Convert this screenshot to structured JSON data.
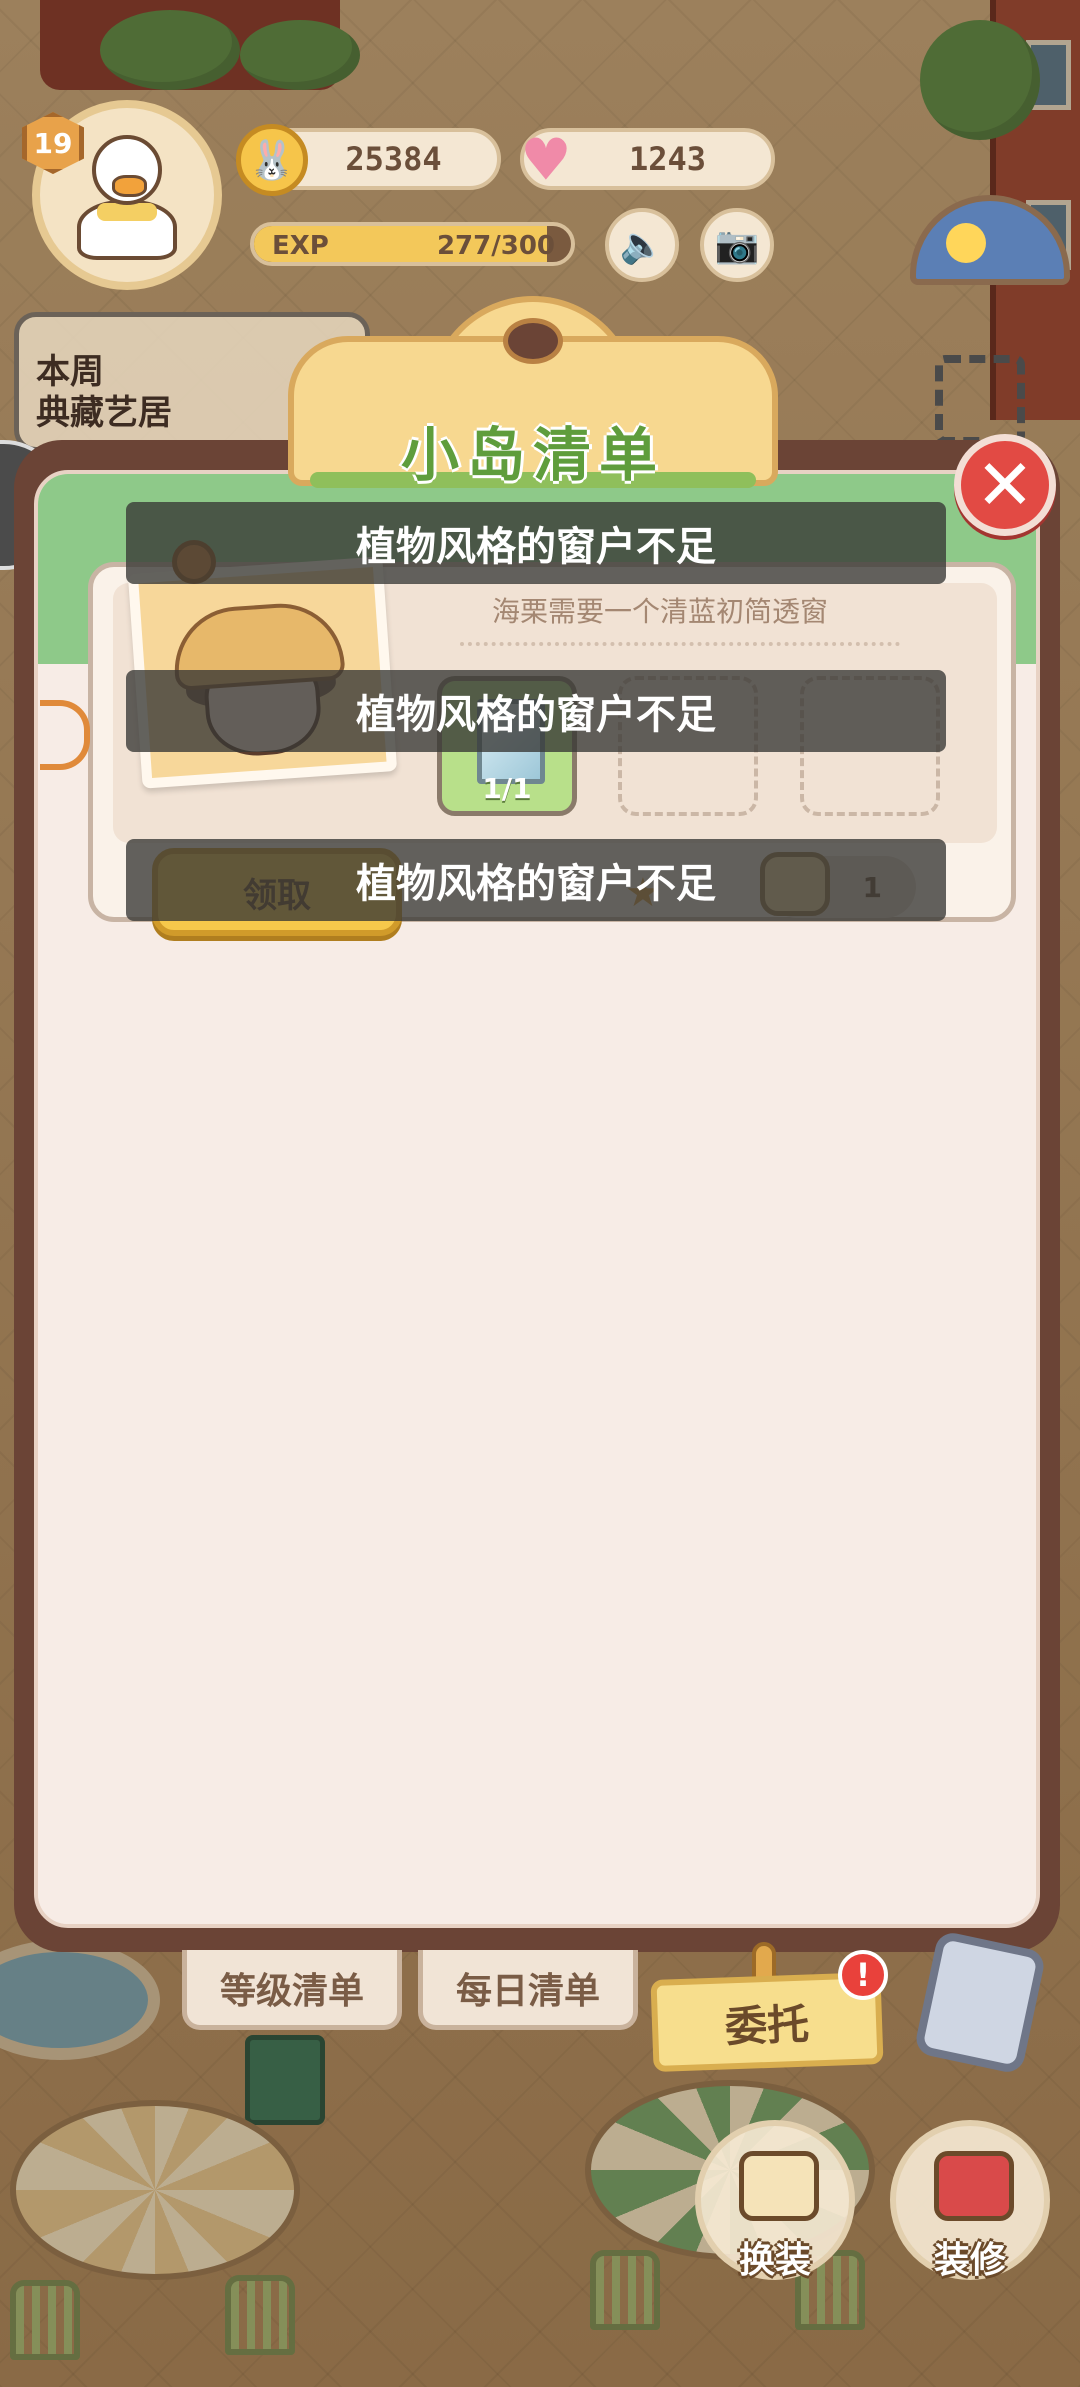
{
  "hud": {
    "level": "19",
    "coins": "25384",
    "hearts": "1243",
    "exp_label": "EXP",
    "exp_value": "277/300",
    "exp_progress": 0.923,
    "weekly_title": "本周\n典藏艺居"
  },
  "panel": {
    "title": "小岛清单",
    "task": {
      "description": "海栗需要一个清蓝初简透窗",
      "item_count": "1/1",
      "claim_label": "领取",
      "reward_amount": "1"
    }
  },
  "toasts": [
    "植物风格的窗户不足",
    "植物风格的窗户不足",
    "植物风格的窗户不足"
  ],
  "tabs": {
    "level_list": "等级清单",
    "daily_list": "每日清单",
    "commission": "委托",
    "commission_alert": "!"
  },
  "actions": {
    "outfit": "换装",
    "decorate": "装修"
  },
  "icons": {
    "level": "hexagon-badge",
    "coins": "rabbit-coin-icon",
    "hearts": "broken-heart-icon",
    "speaker": "speaker-icon",
    "camera": "camera-icon",
    "close": "close-icon",
    "fullscreen": "fullscreen-icon",
    "side_arrow": "chevron-right-icon"
  },
  "colors": {
    "close_button": "#e24a44",
    "title_text": "#5f9d3c",
    "claim_button": "#f6c84b",
    "panel_frame": "#6b4436"
  }
}
